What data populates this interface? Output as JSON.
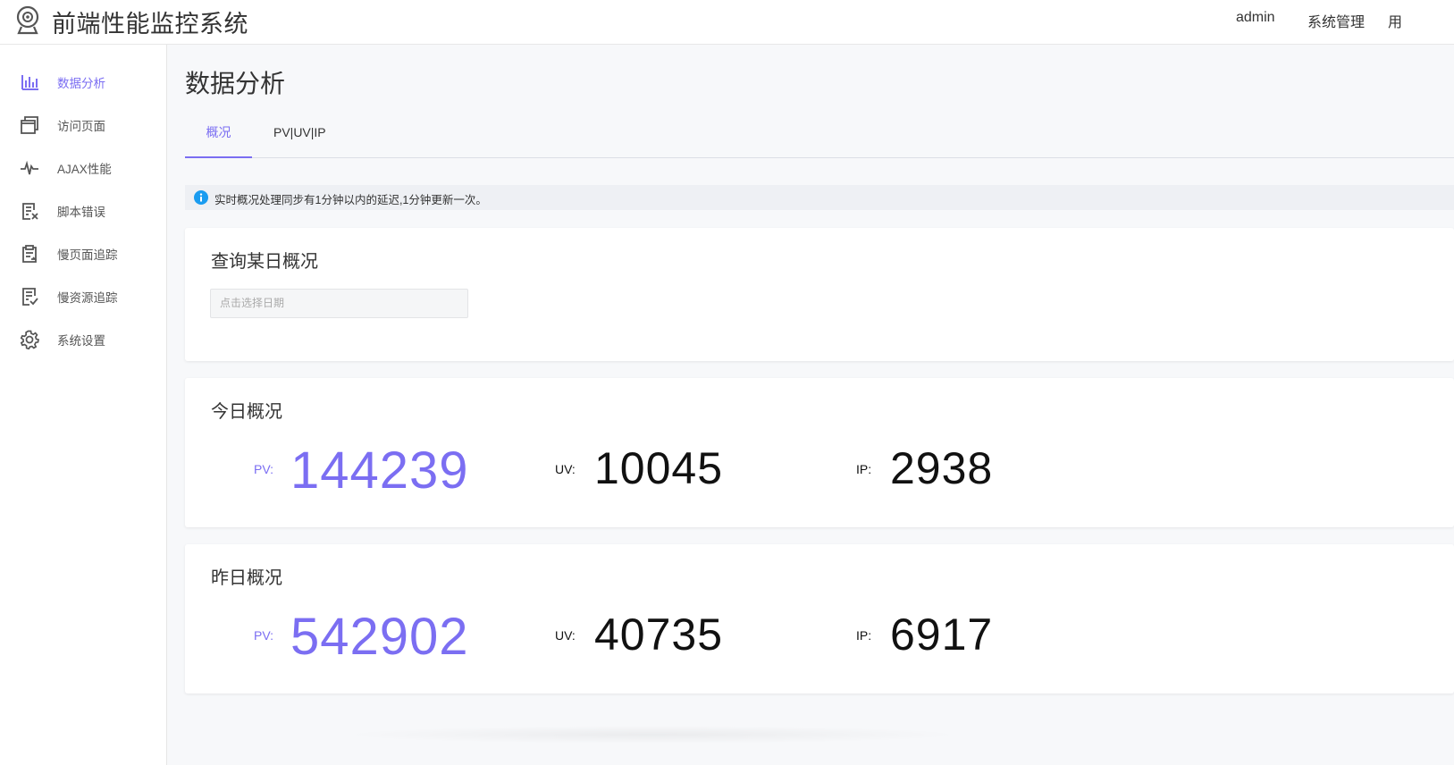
{
  "header": {
    "app_title": "前端性能监控系统",
    "nav": [
      "admin",
      "系统管理",
      "用"
    ]
  },
  "sidebar": {
    "items": [
      {
        "label": "数据分析",
        "icon": "bar-chart-icon",
        "active": true
      },
      {
        "label": "访问页面",
        "icon": "windows-icon",
        "active": false
      },
      {
        "label": "AJAX性能",
        "icon": "pulse-icon",
        "active": false
      },
      {
        "label": "脚本错误",
        "icon": "error-doc-icon",
        "active": false
      },
      {
        "label": "慢页面追踪",
        "icon": "clipboard-icon",
        "active": false
      },
      {
        "label": "慢资源追踪",
        "icon": "check-doc-icon",
        "active": false
      },
      {
        "label": "系统设置",
        "icon": "gear-icon",
        "active": false
      }
    ]
  },
  "main": {
    "page_title": "数据分析",
    "tabs": [
      {
        "label": "概况",
        "active": true
      },
      {
        "label": "PV|UV|IP",
        "active": false
      }
    ],
    "notice": "实时概况处理同步有1分钟以内的延迟,1分钟更新一次。",
    "query_card": {
      "title": "查询某日概况",
      "date_placeholder": "点击选择日期"
    },
    "today": {
      "title": "今日概况",
      "pv_label": "PV:",
      "pv": "144239",
      "uv_label": "UV:",
      "uv": "10045",
      "ip_label": "IP:",
      "ip": "2938"
    },
    "yesterday": {
      "title": "昨日概况",
      "pv_label": "PV:",
      "pv": "542902",
      "uv_label": "UV:",
      "uv": "40735",
      "ip_label": "IP:",
      "ip": "6917"
    }
  },
  "colors": {
    "accent": "#7b6ef2",
    "info": "#1a9cf0"
  }
}
